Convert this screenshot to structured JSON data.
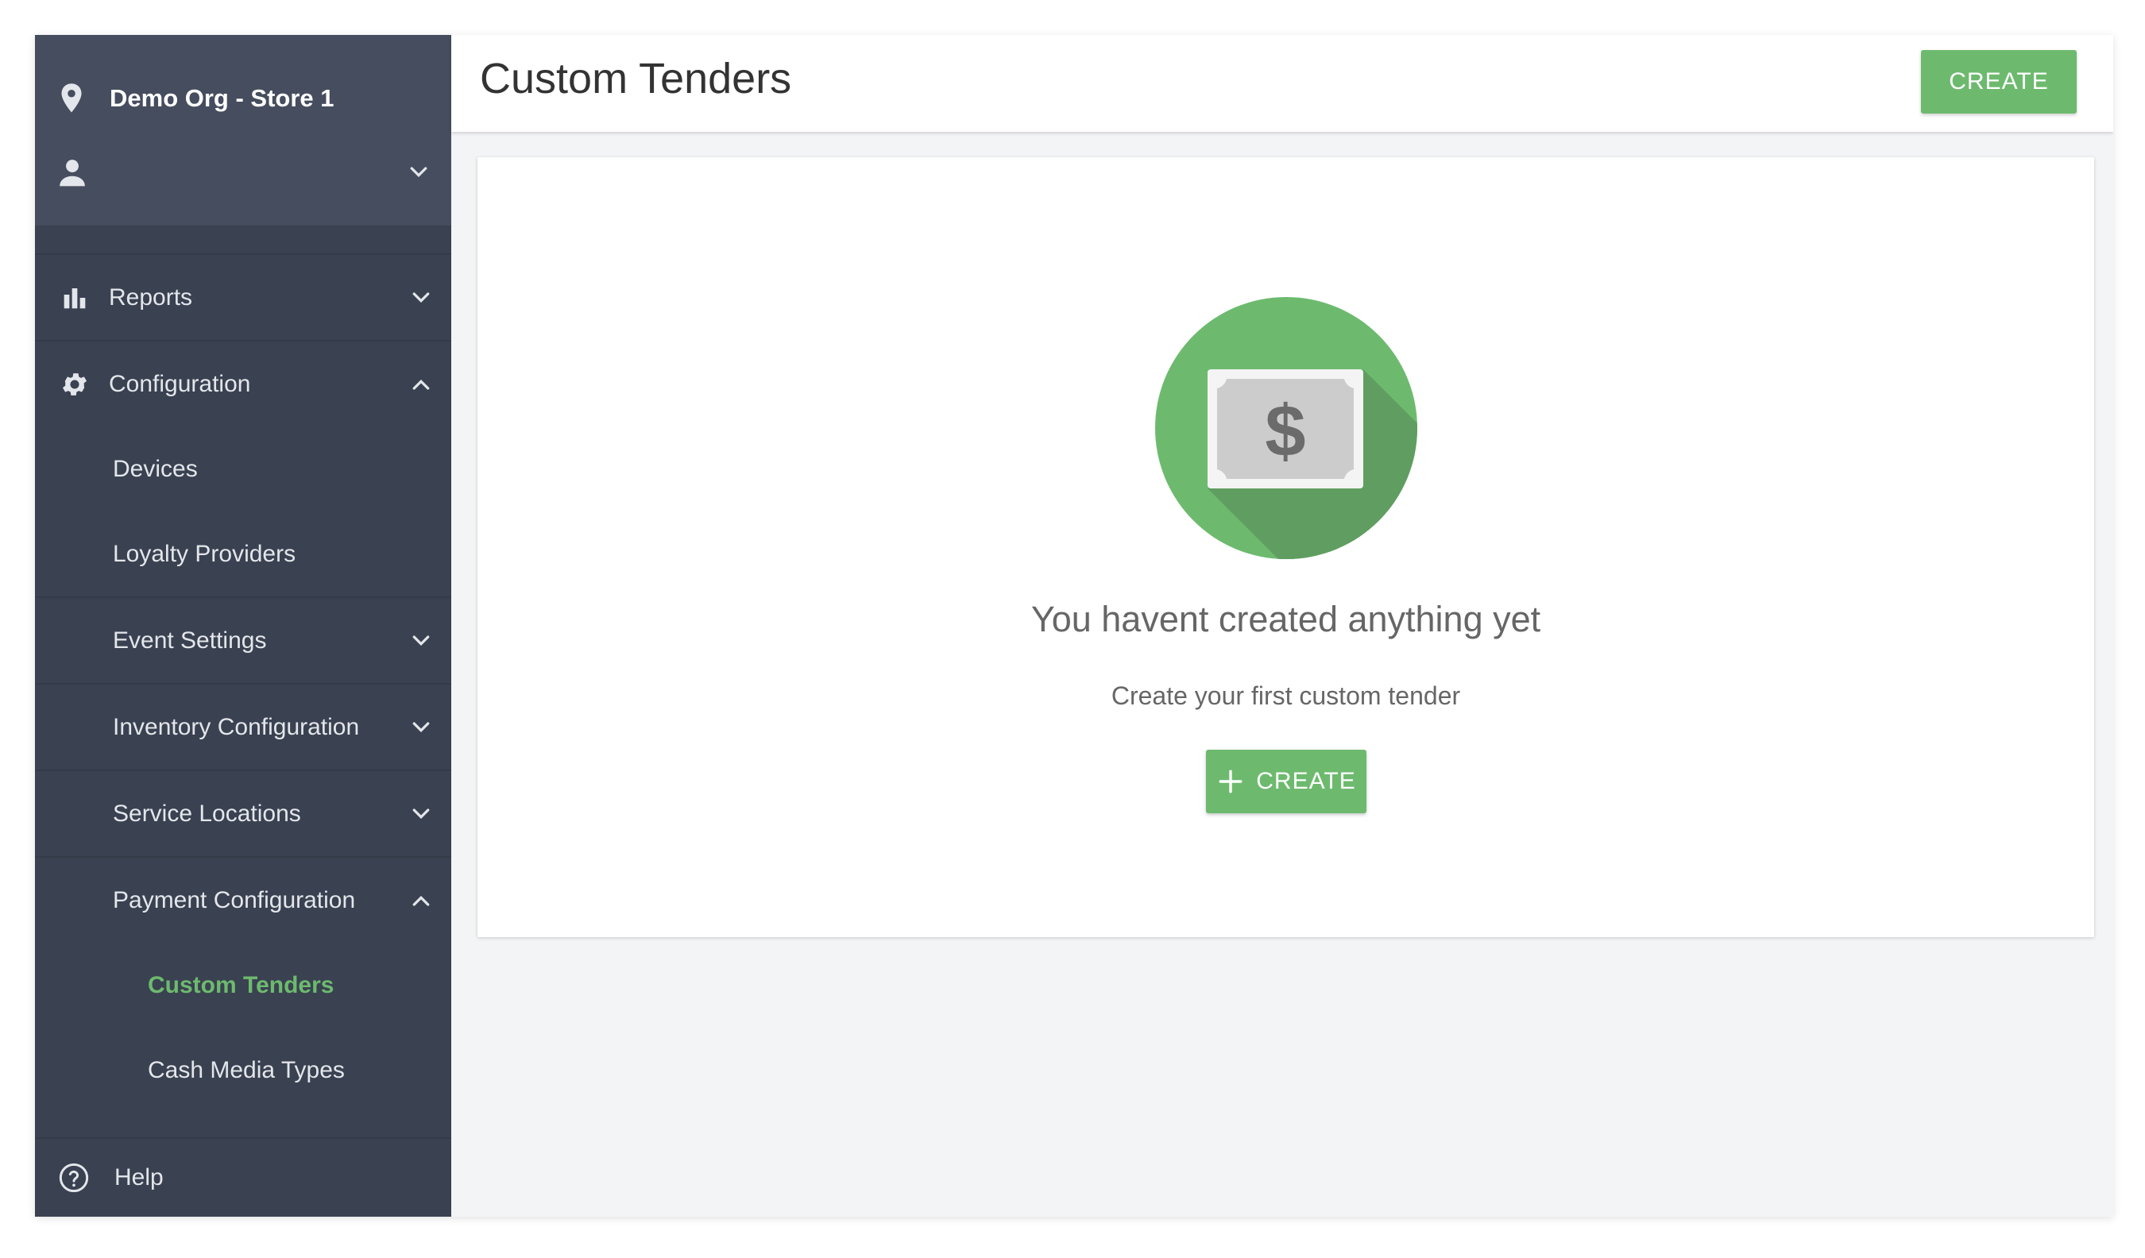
{
  "sidebar": {
    "org_name": "Demo Org - Store 1",
    "items": [
      {
        "label": "Reports",
        "icon": "bar-chart-icon",
        "chevron": "down"
      },
      {
        "label": "Configuration",
        "icon": "gear-icon",
        "chevron": "up"
      },
      {
        "label": "Devices"
      },
      {
        "label": "Loyalty Providers"
      },
      {
        "label": "Event Settings",
        "chevron": "down"
      },
      {
        "label": "Inventory Configuration",
        "chevron": "down"
      },
      {
        "label": "Service Locations",
        "chevron": "down"
      },
      {
        "label": "Payment Configuration",
        "chevron": "up"
      },
      {
        "label": "Custom Tenders",
        "active": true
      },
      {
        "label": "Cash Media Types"
      }
    ],
    "help_label": "Help"
  },
  "header": {
    "title": "Custom Tenders",
    "create_label": "CREATE"
  },
  "empty_state": {
    "title": "You havent created anything yet",
    "subtitle": "Create your first custom tender",
    "create_label": "CREATE",
    "icon": "money-bill-icon"
  },
  "colors": {
    "accent": "#6dba6e",
    "sidebar_bg": "#3a4151",
    "sidebar_header_bg": "#454d5e",
    "content_bg": "#f3f4f6"
  }
}
